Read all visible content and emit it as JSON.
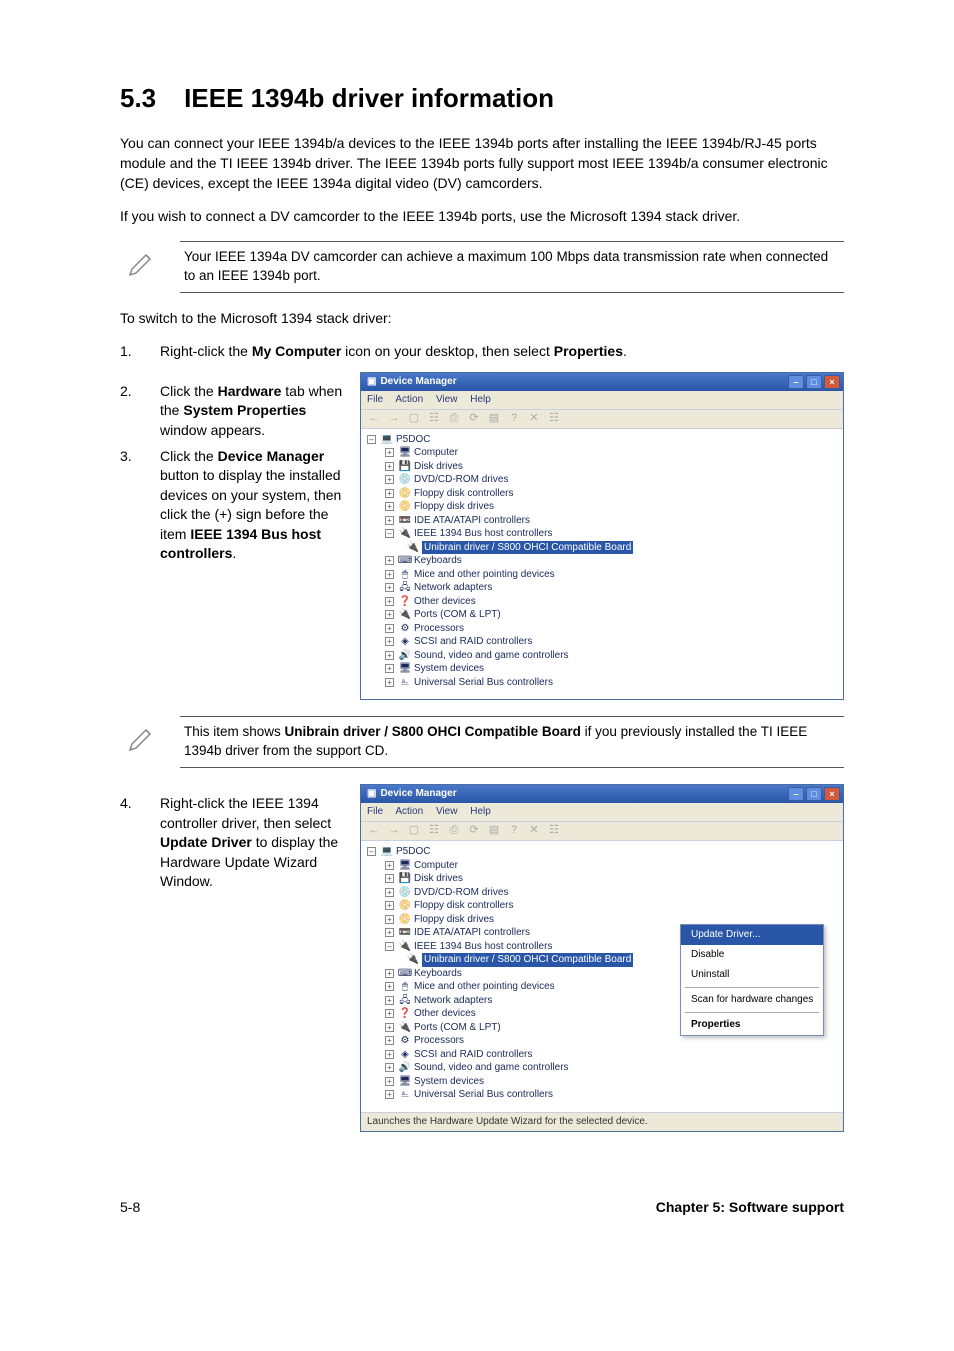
{
  "section": {
    "number": "5.3",
    "title": "IEEE 1394b driver information"
  },
  "para1": "You can connect your IEEE 1394b/a devices to the IEEE 1394b ports after installing the IEEE 1394b/RJ-45 ports module and the TI IEEE 1394b driver. The IEEE 1394b ports fully support most IEEE 1394b/a consumer electronic (CE) devices, except the IEEE 1394a digital video (DV) camcorders.",
  "para2": "If you wish to connect a DV camcorder to the IEEE 1394b ports, use the Microsoft 1394 stack driver.",
  "note1": "Your IEEE 1394a DV camcorder can achieve a maximum 100 Mbps data transmission rate when connected to an IEEE 1394b port.",
  "para3": "To switch to the Microsoft 1394 stack driver:",
  "steps": {
    "s1": {
      "pre": "Right-click the ",
      "bold1": "My Computer",
      "mid": " icon on your desktop, then select ",
      "bold2": "Properties",
      "post": "."
    },
    "s2": {
      "pre": "Click the ",
      "bold1": "Hardware",
      "mid": " tab when the ",
      "bold2": "System Properties",
      "post": " window appears."
    },
    "s3": {
      "pre": "Click the ",
      "bold1": "Device Manager",
      "mid": " button to display the installed devices on your system, then click the (+) sign before the item ",
      "bold2": "IEEE 1394 Bus host controllers",
      "post": "."
    },
    "s4": {
      "pre": "Right-click the IEEE 1394 controller driver, then select ",
      "bold1": "Update Driver",
      "post": " to display the Hardware Update Wizard Window."
    }
  },
  "note2": {
    "pre": "This item shows ",
    "bold": "Unibrain driver / S800 OHCI Compatible Board",
    "post": " if you previously installed the TI IEEE 1394b driver from the support CD."
  },
  "dm": {
    "title": "Device Manager",
    "menu": {
      "file": "File",
      "action": "Action",
      "view": "View",
      "help": "Help"
    },
    "root": "P5DOC",
    "items": [
      "Computer",
      "Disk drives",
      "DVD/CD-ROM drives",
      "Floppy disk controllers",
      "Floppy disk drives",
      "IDE ATA/ATAPI controllers",
      "IEEE 1394 Bus host controllers",
      "Keyboards",
      "Mice and other pointing devices",
      "Network adapters",
      "Other devices",
      "Ports (COM & LPT)",
      "Processors",
      "SCSI and RAID controllers",
      "Sound, video and game controllers",
      "System devices",
      "Universal Serial Bus controllers"
    ],
    "selected": "Unibrain driver / S800 OHCI Compatible Board",
    "ctx": {
      "update": "Update Driver...",
      "disable": "Disable",
      "uninstall": "Uninstall",
      "scan": "Scan for hardware changes",
      "properties": "Properties"
    },
    "status": "Launches the Hardware Update Wizard for the selected device."
  },
  "toolbar_glyphs": {
    "back": "←",
    "fwd": "→",
    "up": "▢",
    "prop": "☷",
    "print": "⎙",
    "refresh": "⟳",
    "tree": "▤",
    "x": "✕",
    "help": "?"
  },
  "footer": {
    "left": "5-8",
    "right": "Chapter 5: Software support"
  }
}
